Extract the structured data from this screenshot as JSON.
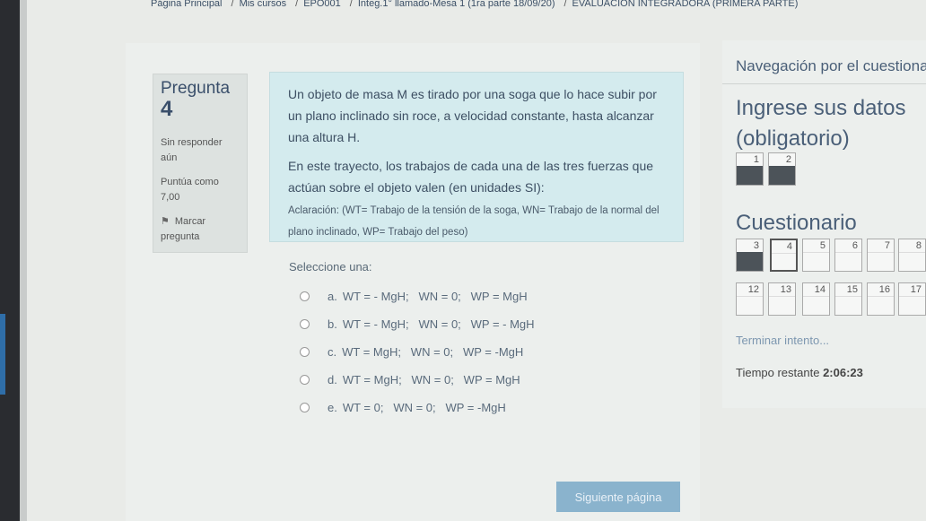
{
  "breadcrumb": {
    "items": [
      "Página Principal",
      "Mis cursos",
      "EPO001",
      "Integ.1° llamado-Mesa 1 (1ra parte 18/09/20)",
      "EVALUACIÓN INTEGRADORA (PRIMERA PARTE)"
    ],
    "separator": "/"
  },
  "question_info": {
    "label": "Pregunta",
    "number": "4",
    "status": "Sin responder aún",
    "grade": "Puntúa como 7,00",
    "flag_label": "Marcar pregunta"
  },
  "question": {
    "text1": "Un objeto de masa M es tirado por una soga que lo hace subir por un plano inclinado sin roce, a velocidad constante, hasta alcanzar una altura H.",
    "text2": "En este trayecto, los trabajos de cada una de las tres fuerzas que actúan sobre el objeto valen (en unidades SI):",
    "note": "Aclaración: (WT= Trabajo de la tensión de la soga, WN= Trabajo de la normal del plano inclinado, WP= Trabajo del peso)"
  },
  "answer": {
    "prompt": "Seleccione una:",
    "options": [
      {
        "letter": "a.",
        "text": "WT = - MgH;   WN = 0;   WP = MgH"
      },
      {
        "letter": "b.",
        "text": "WT = - MgH;   WN = 0;   WP = - MgH"
      },
      {
        "letter": "c.",
        "text": "WT = MgH;   WN = 0;   WP = -MgH"
      },
      {
        "letter": "d.",
        "text": "WT = MgH;   WN = 0;   WP = MgH"
      },
      {
        "letter": "e.",
        "text": "WT = 0;   WN = 0;   WP = -MgH"
      }
    ]
  },
  "next_button": "Siguiente página",
  "navigation": {
    "title": "Navegación por el cuestionario",
    "section1_title": "Ingrese sus datos (obligatorio)",
    "section1_buttons": [
      {
        "num": "1",
        "answered": true
      },
      {
        "num": "2",
        "answered": true
      }
    ],
    "section2_title": "Cuestionario",
    "section2_row1": [
      {
        "num": "3",
        "answered": true,
        "current": false
      },
      {
        "num": "4",
        "answered": false,
        "current": true
      },
      {
        "num": "5",
        "answered": false,
        "current": false
      },
      {
        "num": "6",
        "answered": false,
        "current": false
      },
      {
        "num": "7",
        "answered": false,
        "current": false
      },
      {
        "num": "8",
        "answered": false,
        "current": false
      }
    ],
    "section2_row2": [
      {
        "num": "12",
        "answered": false
      },
      {
        "num": "13",
        "answered": false
      },
      {
        "num": "14",
        "answered": false
      },
      {
        "num": "15",
        "answered": false
      },
      {
        "num": "16",
        "answered": false
      },
      {
        "num": "17",
        "answered": false
      }
    ],
    "finish_link": "Terminar intento...",
    "timer_label": "Tiempo restante",
    "timer_value": "2:06:23"
  },
  "colors": {
    "question_bg": "#d4ebee",
    "info_bg": "#dde2e0",
    "button_bg": "#8ab3cd",
    "answered_block": "#4c5359"
  }
}
